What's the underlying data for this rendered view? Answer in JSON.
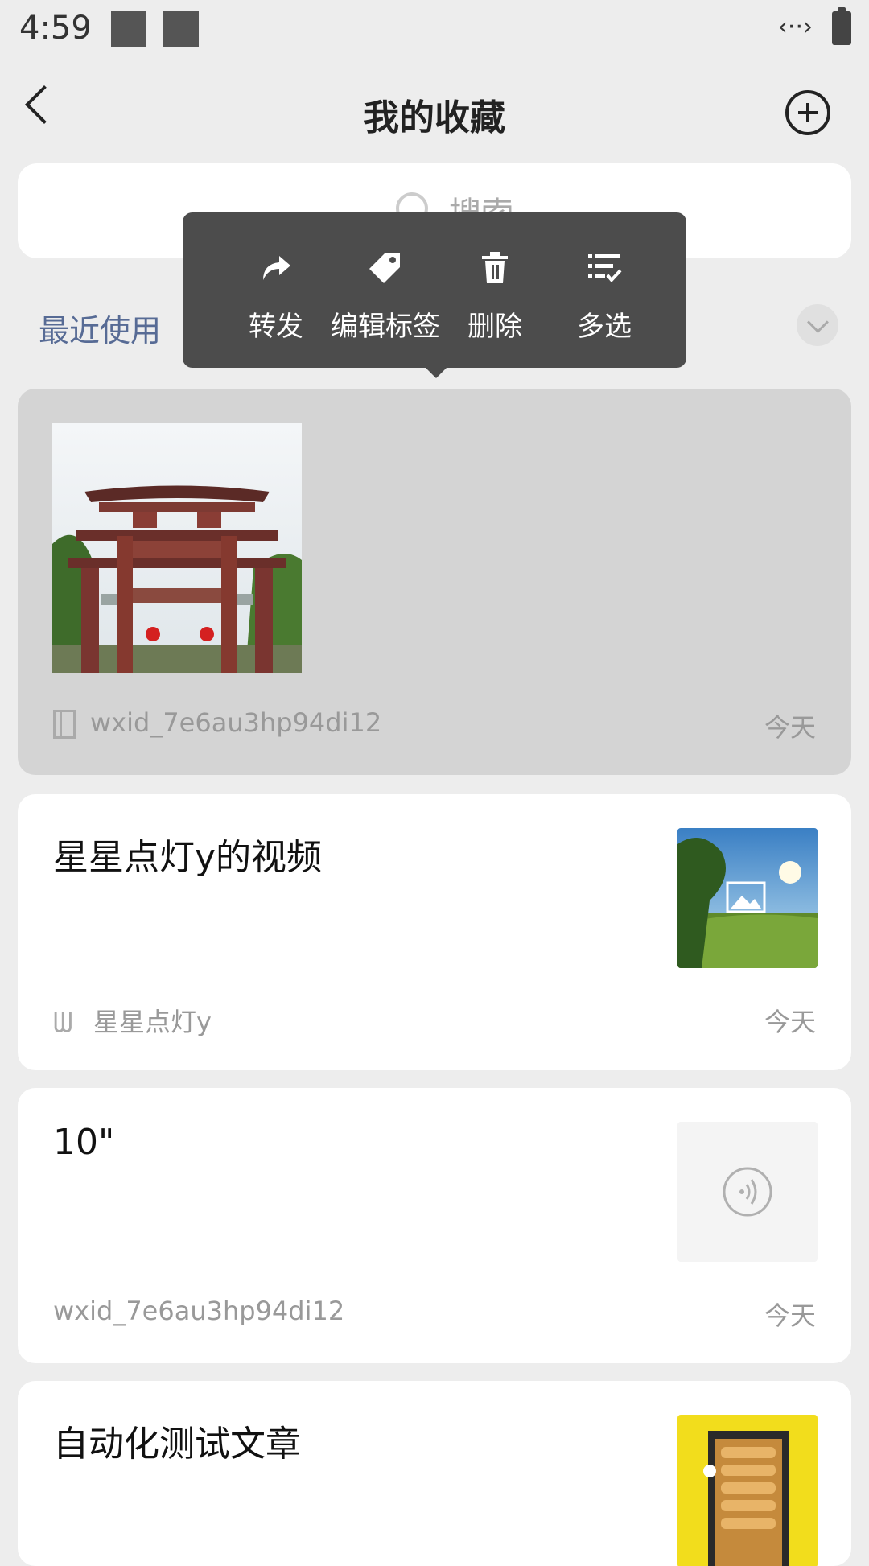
{
  "status_bar": {
    "time": "4:59",
    "network_icon": "data-transfer-icon",
    "battery_icon": "battery-icon"
  },
  "header": {
    "title": "我的收藏",
    "back_icon": "back-chevron-icon",
    "add_icon": "add-circle-icon"
  },
  "search": {
    "placeholder": "搜索"
  },
  "filter": {
    "recent_label": "最近使用"
  },
  "popup_menu": {
    "items": [
      {
        "label": "转发",
        "icon": "forward-icon"
      },
      {
        "label": "编辑标签",
        "icon": "tag-icon"
      },
      {
        "label": "删除",
        "icon": "trash-icon"
      },
      {
        "label": "多选",
        "icon": "multi-select-icon"
      }
    ]
  },
  "favorites": [
    {
      "type": "image",
      "source": "wxid_7e6au3hp94di12",
      "date": "今天",
      "selected": true
    },
    {
      "type": "video",
      "title": "星星点灯y的视频",
      "source": "星星点灯y",
      "date": "今天"
    },
    {
      "type": "voice",
      "title": "10\"",
      "source": "wxid_7e6au3hp94di12",
      "date": "今天"
    },
    {
      "type": "article",
      "title": "自动化测试文章"
    }
  ]
}
